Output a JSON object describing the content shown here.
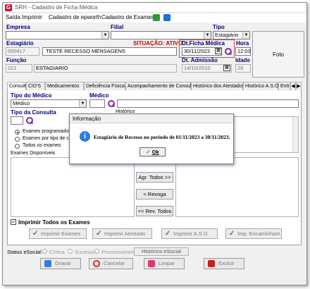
{
  "window": {
    "title": "SRH - Cadastro de Ficha Médica"
  },
  "menu": [
    "Saída",
    "Imprimir",
    "Cadastro de epworth",
    "Cadastro de Exames"
  ],
  "labels": {
    "empresa": "Empresa",
    "filial": "Filial",
    "tipo": "Tipo",
    "estagiario": "Estagiário",
    "situacao": "SITUAÇÃO: ATIVO",
    "dt_ficha": "Dt.Ficha Médica",
    "hora": "Hora",
    "funcao": "Função",
    "dt_admissao": "Dt. Admissão",
    "idade": "Idade",
    "foto": "Foto"
  },
  "fields": {
    "tipo": "Estagiário",
    "estagiario_code": "000417",
    "estagiario_name": "TESTE RECESSO MENSAGENS",
    "dt_ficha": "30/11/2023",
    "hora": "12:03",
    "funcao_code": "221",
    "funcao_name": "ESTAGIARIO",
    "dt_admissao": "14/10/2010",
    "idade": "29"
  },
  "tabs": [
    "Consulta",
    "CID'S",
    "Medicamentos",
    "Deficiência Física",
    "Acompanhamento de Consulta",
    "Histórico dos Atestados",
    "Histórico A.S.O.",
    "Entr"
  ],
  "panel": {
    "tipo_medico_label": "Tipo do Médico",
    "tipo_medico_value": "Médico",
    "medico_label": "Médico",
    "tipo_consulta_label": "Tipo da Consulta",
    "historico_label": "Histórico",
    "radios": [
      "Exames programados",
      "Exames por tipo de co",
      "Todos os exames"
    ],
    "exames_disponiveis": "Exames Disponíveis",
    "agr_todos": "Agr. Todos >>",
    "revoga": "< Revoga",
    "rev_todos": "<< Rev. Todos",
    "imprimir_todos": "Imprimir Todos os Exames",
    "print_buttons": [
      "Imprimir Exames",
      "Imprimir Atestado",
      "Imprimir A.S.O",
      "Imp. Encaminham"
    ]
  },
  "dialog": {
    "title": "Informação",
    "message": "Estagiário de Recesso no periodo de 01/11/2023 a 30/11/2023.",
    "ok": "Ok"
  },
  "status": {
    "label": "Status eSocial:",
    "options": [
      "Crítica",
      "Sucesso",
      "Processamento"
    ],
    "historico": "Histórico eSocial"
  },
  "footer": [
    "Gravar",
    "Cancelar",
    "Limpar",
    "Excluir"
  ],
  "colors": {
    "label_blue": "#00007a",
    "situacao_red": "#d00000",
    "accent_purple": "#7a2fa0"
  }
}
